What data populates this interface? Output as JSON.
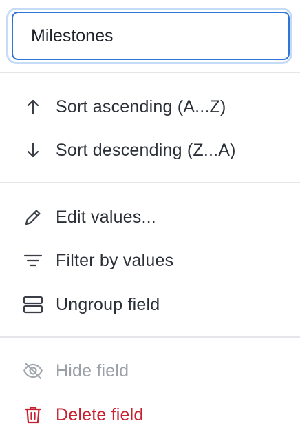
{
  "field_name": {
    "value": "Milestones"
  },
  "menu": {
    "sort_ascending": {
      "label": "Sort ascending (A...Z)",
      "icon": "arrow-up-icon"
    },
    "sort_descending": {
      "label": "Sort descending (Z...A)",
      "icon": "arrow-down-icon"
    },
    "edit_values": {
      "label": "Edit values...",
      "icon": "pencil-icon"
    },
    "filter_by_values": {
      "label": "Filter by values",
      "icon": "filter-icon"
    },
    "ungroup_field": {
      "label": "Ungroup field",
      "icon": "ungroup-icon"
    },
    "hide_field": {
      "label": "Hide field",
      "icon": "eye-off-icon",
      "disabled": true
    },
    "delete_field": {
      "label": "Delete field",
      "icon": "trash-icon"
    }
  },
  "colors": {
    "focus_border": "#2f75d6",
    "focus_ring": "#c6dbf6",
    "text": "#2b3038",
    "muted": "#9aa0a6",
    "danger": "#c8202f",
    "divider": "#e4e6e9"
  }
}
